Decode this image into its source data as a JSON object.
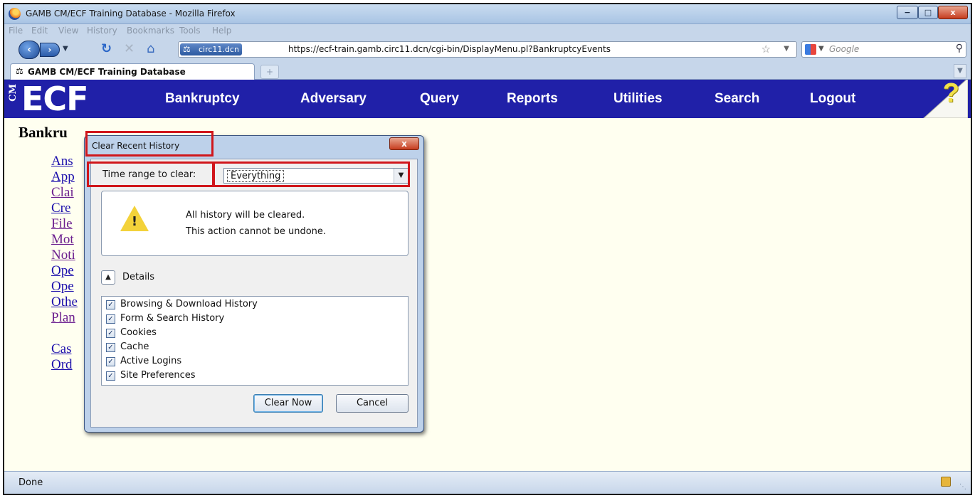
{
  "window": {
    "title": "GAMB CM/ECF Training Database - Mozilla Firefox",
    "controls": [
      "−",
      "□",
      "x"
    ]
  },
  "menubar": {
    "items": [
      "File",
      "Edit",
      "View",
      "History",
      "Bookmarks",
      "Tools",
      "Help"
    ]
  },
  "navbar": {
    "site_identity": "circ11.dcn",
    "url": "https://ecf-train.gamb.circ11.dcn/cgi-bin/DisplayMenu.pl?BankruptcyEvents",
    "search_engine": "Google"
  },
  "tabs": [
    {
      "label": "GAMB CM/ECF Training Database",
      "active": true
    }
  ],
  "ecf": {
    "logo_main": "ECF",
    "logo_prefix": "CM",
    "nav": [
      "Bankruptcy",
      "Adversary",
      "Query",
      "Reports",
      "Utilities",
      "Search",
      "Logout"
    ],
    "help_glyph": "?"
  },
  "page": {
    "heading_visible": "Bankru",
    "links": [
      "Ans",
      "App",
      "Clai",
      "Cre",
      "File",
      "Mot",
      "Noti",
      "Ope",
      "Ope",
      "Othe",
      "Plan"
    ],
    "links2": [
      "Cas",
      "Ord"
    ]
  },
  "dialog": {
    "title": "Clear Recent History",
    "close_glyph": "x",
    "time_range_label": "Time range to clear:",
    "time_range_value": "Everything",
    "warning_line1": "All history will be cleared.",
    "warning_line2": "This action cannot be undone.",
    "details_label": "Details",
    "items": [
      {
        "label": "Browsing & Download History",
        "checked": true
      },
      {
        "label": "Form & Search History",
        "checked": true
      },
      {
        "label": "Cookies",
        "checked": true
      },
      {
        "label": "Cache",
        "checked": true
      },
      {
        "label": "Active Logins",
        "checked": true
      },
      {
        "label": "Site Preferences",
        "checked": true
      }
    ],
    "clear_now": "Clear Now",
    "cancel": "Cancel"
  },
  "status": {
    "text": "Done"
  },
  "colors": {
    "ecf_bar": "#2020a8",
    "highlight": "#d0161b",
    "page_bg": "#fffff0"
  }
}
